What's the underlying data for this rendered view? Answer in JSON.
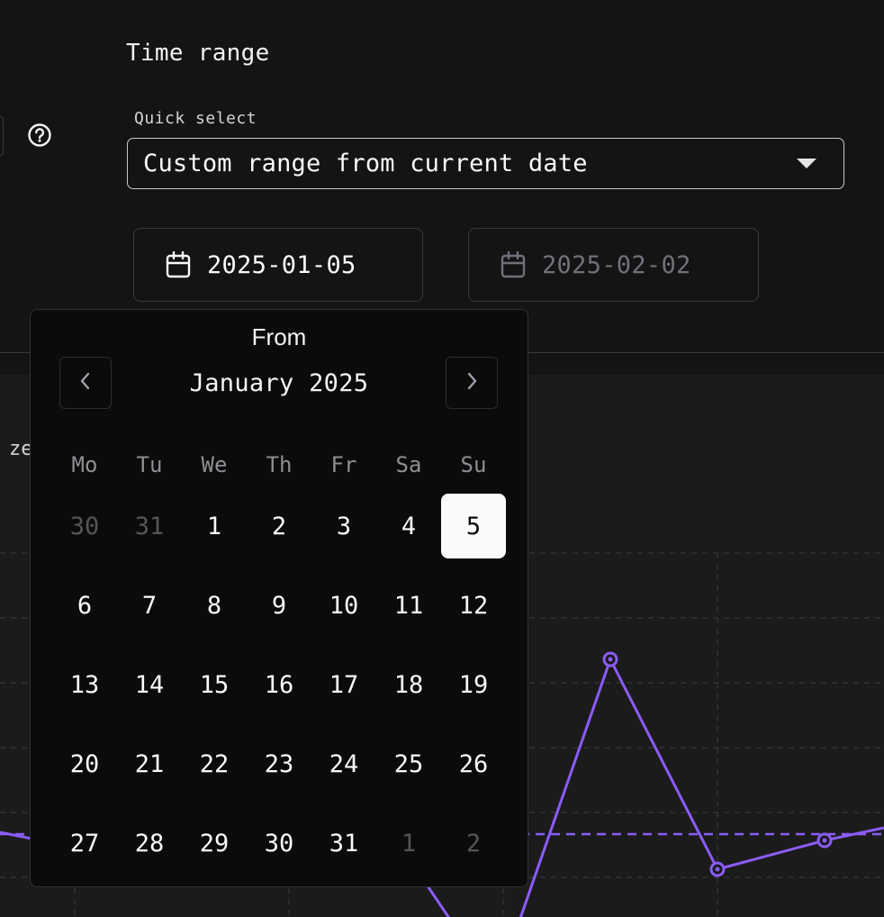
{
  "time_range": {
    "title": "Time range",
    "quick_select_label": "Quick select",
    "quick_select_value": "Custom range from current date",
    "from_date": "2025-01-05",
    "to_date": "2025-02-02"
  },
  "chart": {
    "partial_label": "ze",
    "line_color": "#8b5cf6"
  },
  "calendar": {
    "title": "From",
    "month_label": "January 2025",
    "weekdays": [
      "Mo",
      "Tu",
      "We",
      "Th",
      "Fr",
      "Sa",
      "Su"
    ],
    "weeks": [
      [
        "30",
        "31",
        "1",
        "2",
        "3",
        "4",
        "5"
      ],
      [
        "6",
        "7",
        "8",
        "9",
        "10",
        "11",
        "12"
      ],
      [
        "13",
        "14",
        "15",
        "16",
        "17",
        "18",
        "19"
      ],
      [
        "20",
        "21",
        "22",
        "23",
        "24",
        "25",
        "26"
      ],
      [
        "27",
        "28",
        "29",
        "30",
        "31",
        "1",
        "2"
      ]
    ],
    "outside_month": [
      [
        0,
        0
      ],
      [
        0,
        1
      ],
      [
        4,
        5
      ],
      [
        4,
        6
      ]
    ],
    "selected_day": "5",
    "accent_color": "#fafafa"
  }
}
